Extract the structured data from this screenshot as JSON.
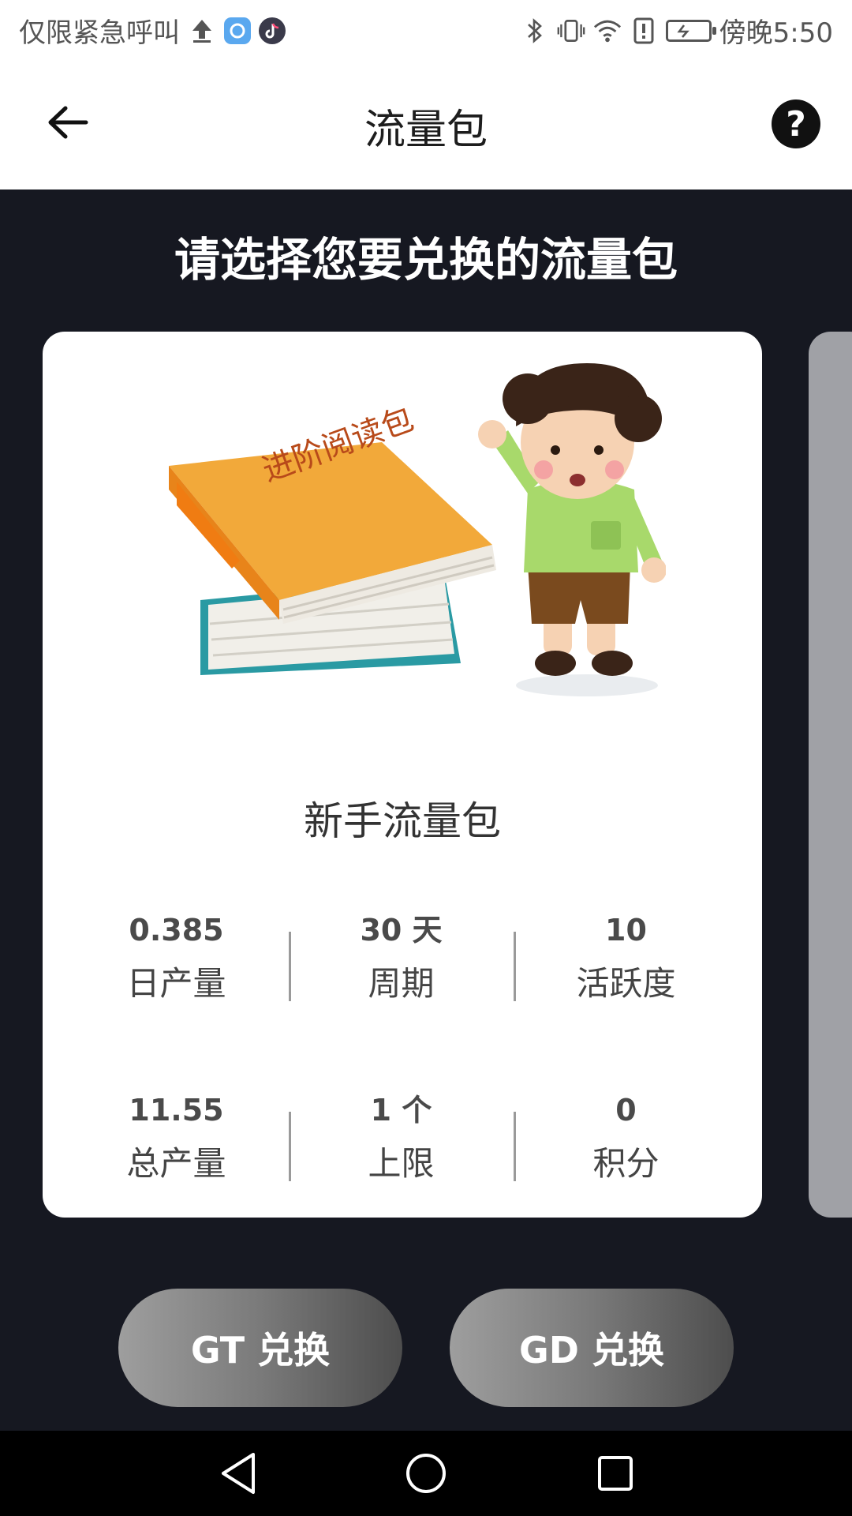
{
  "status_bar": {
    "left_text": "仅限紧急呼叫",
    "time": "傍晚5:50",
    "icons": [
      "upload-icon",
      "app-blue-icon",
      "tiktok-icon",
      "bluetooth-icon",
      "vibrate-icon",
      "wifi-icon",
      "alert-icon",
      "battery-icon"
    ]
  },
  "header": {
    "title": "流量包",
    "help_label": "?"
  },
  "main": {
    "heading": "请选择您要兑换的流量包"
  },
  "card": {
    "illustration_text": "进阶阅读包",
    "name": "新手流量包",
    "stats": [
      {
        "value": "0.385",
        "label": "日产量"
      },
      {
        "value": "30 天",
        "label": "周期"
      },
      {
        "value": "10",
        "label": "活跃度"
      },
      {
        "value": "11.55",
        "label": "总产量"
      },
      {
        "value": "1 个",
        "label": "上限"
      },
      {
        "value": "0",
        "label": "积分"
      }
    ]
  },
  "actions": {
    "gt_label": "GT 兑换",
    "gd_label": "GD 兑换"
  },
  "colors": {
    "background": "#161821",
    "card": "#ffffff",
    "button_start": "#9e9e9e",
    "button_end": "#4d4d4d"
  }
}
